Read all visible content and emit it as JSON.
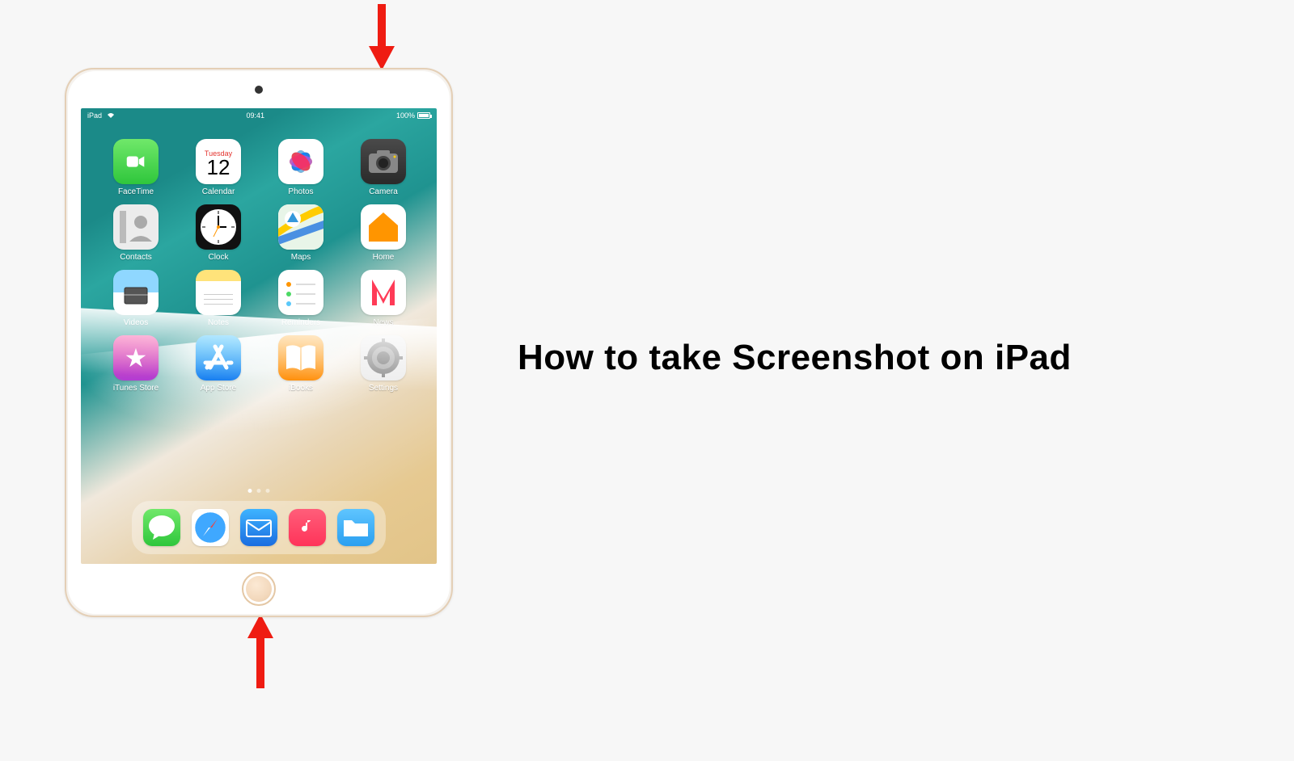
{
  "title": "How to take Screenshot on iPad",
  "device": {
    "status": {
      "left": "iPad",
      "time": "09:41",
      "battery": "100%"
    },
    "calendar": {
      "day_name": "Tuesday",
      "day_num": "12"
    },
    "apps": [
      {
        "name": "FaceTime",
        "icon": "facetime"
      },
      {
        "name": "Calendar",
        "icon": "calendar"
      },
      {
        "name": "Photos",
        "icon": "photos"
      },
      {
        "name": "Camera",
        "icon": "camera"
      },
      {
        "name": "Contacts",
        "icon": "contacts"
      },
      {
        "name": "Clock",
        "icon": "clock"
      },
      {
        "name": "Maps",
        "icon": "maps"
      },
      {
        "name": "Home",
        "icon": "home"
      },
      {
        "name": "Videos",
        "icon": "videos"
      },
      {
        "name": "Notes",
        "icon": "notes"
      },
      {
        "name": "Reminders",
        "icon": "reminders"
      },
      {
        "name": "News",
        "icon": "news"
      },
      {
        "name": "iTunes Store",
        "icon": "itunes"
      },
      {
        "name": "App Store",
        "icon": "appstore"
      },
      {
        "name": "iBooks",
        "icon": "ibooks"
      },
      {
        "name": "Settings",
        "icon": "settings"
      }
    ],
    "dock": [
      {
        "name": "Messages",
        "icon": "messages"
      },
      {
        "name": "Safari",
        "icon": "safari"
      },
      {
        "name": "Mail",
        "icon": "mail"
      },
      {
        "name": "Music",
        "icon": "music"
      },
      {
        "name": "Files",
        "icon": "files"
      }
    ]
  },
  "annotations": {
    "top_arrow_target": "sleep-wake-button",
    "bottom_arrow_target": "home-button"
  },
  "colors": {
    "arrow": "#ef1c12",
    "page_bg": "#f7f7f7"
  }
}
